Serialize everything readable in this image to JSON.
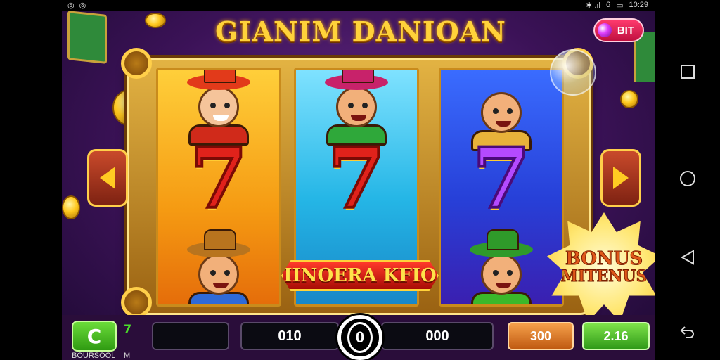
{
  "status_bar": {
    "left_icons": "◎ ◎",
    "signal": "✱ .ıl",
    "battery": "6",
    "time": "10:29"
  },
  "header": {
    "title": "GIANIM DANIOAN",
    "bit_button_label": "BIT"
  },
  "reels": [
    {
      "symbol": "7",
      "top_character": "old-man-cowboy",
      "bottom_character": "cowboy"
    },
    {
      "symbol": "7",
      "top_character": "pirate-kid",
      "bottom_character": "hat"
    },
    {
      "symbol": "7",
      "top_character": "farmer",
      "bottom_character": "green-hat-kid"
    }
  ],
  "win_banner": "IINOERA KFIO",
  "bonus": {
    "line1": "BONUS",
    "line2": "MITENUS"
  },
  "controls": {
    "back_icon": "C",
    "mini_seven": "7",
    "mini_label_left": "BOURSOOL",
    "mini_label_right": "M",
    "field_empty": "",
    "field_left_value": "010",
    "spin_label": "0",
    "field_right_value": "000",
    "orange_button": "300",
    "green_button": "2.16"
  },
  "nav_bar": {
    "icons": [
      "square-icon",
      "circle-icon",
      "triangle-icon",
      "back-icon"
    ]
  },
  "colors": {
    "accent_gold": "#ffd23a",
    "background_purple": "#3b1257",
    "win_red": "#e0221b"
  }
}
